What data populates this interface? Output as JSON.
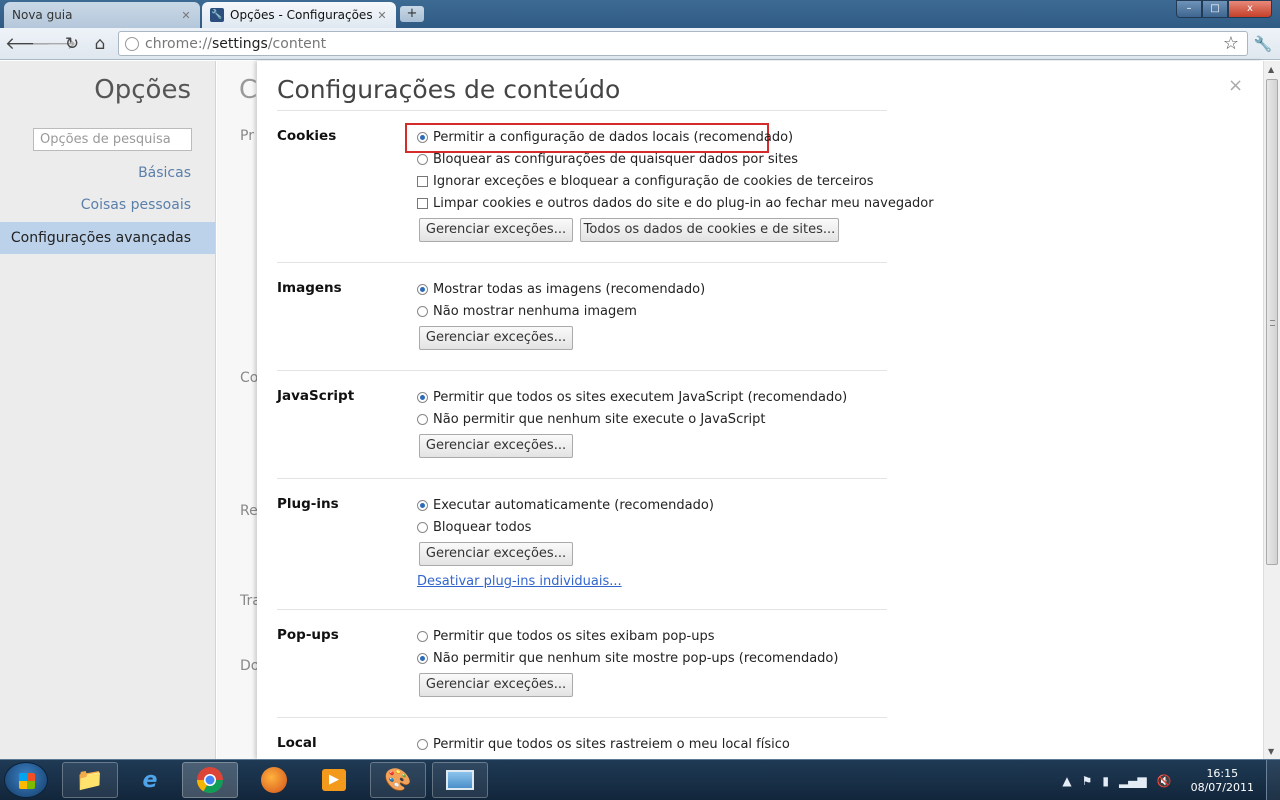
{
  "browser": {
    "tabs": [
      {
        "title": "Nova guia",
        "active": false
      },
      {
        "title": "Opções - Configurações de",
        "active": true
      }
    ],
    "new_tab_symbol": "+",
    "window_controls": {
      "minimize": "–",
      "maximize": "□",
      "close": "x"
    },
    "url_prefix": "chrome://",
    "url_path": "settings",
    "url_suffix": "/content"
  },
  "sidebar": {
    "title": "Opções",
    "search_placeholder": "Opções de pesquisa",
    "items": [
      {
        "label": "Básicas",
        "selected": false
      },
      {
        "label": "Coisas pessoais",
        "selected": false
      },
      {
        "label": "Configurações avançadas",
        "selected": true
      }
    ]
  },
  "background_page": {
    "title_fragment": "C",
    "section_fragments": [
      "Pr",
      "Co",
      "Re",
      "Tra",
      "Do"
    ]
  },
  "dialog": {
    "title": "Configurações de conteúdo",
    "close_symbol": "×",
    "sections": {
      "cookies": {
        "heading": "Cookies",
        "options": [
          {
            "type": "radio",
            "checked": true,
            "label": "Permitir a configuração de dados locais (recomendado)"
          },
          {
            "type": "radio",
            "checked": false,
            "label": "Bloquear as configurações de quaisquer dados por sites"
          },
          {
            "type": "checkbox",
            "checked": false,
            "label": "Ignorar exceções e bloquear a configuração de cookies de terceiros"
          },
          {
            "type": "checkbox",
            "checked": false,
            "label": "Limpar cookies e outros dados do site e do plug-in ao fechar meu navegador"
          }
        ],
        "buttons": [
          "Gerenciar exceções...",
          "Todos os dados de cookies e de sites..."
        ]
      },
      "images": {
        "heading": "Imagens",
        "options": [
          {
            "type": "radio",
            "checked": true,
            "label": "Mostrar todas as imagens (recomendado)"
          },
          {
            "type": "radio",
            "checked": false,
            "label": "Não mostrar nenhuma imagem"
          }
        ],
        "button": "Gerenciar exceções..."
      },
      "javascript": {
        "heading": "JavaScript",
        "options": [
          {
            "type": "radio",
            "checked": true,
            "label": "Permitir que todos os sites executem JavaScript (recomendado)"
          },
          {
            "type": "radio",
            "checked": false,
            "label": "Não permitir que nenhum site execute o JavaScript"
          }
        ],
        "button": "Gerenciar exceções..."
      },
      "plugins": {
        "heading": "Plug-ins",
        "options": [
          {
            "type": "radio",
            "checked": true,
            "label": "Executar automaticamente (recomendado)"
          },
          {
            "type": "radio",
            "checked": false,
            "label": "Bloquear todos"
          }
        ],
        "button": "Gerenciar exceções...",
        "link": "Desativar plug-ins individuais..."
      },
      "popups": {
        "heading": "Pop-ups",
        "options": [
          {
            "type": "radio",
            "checked": false,
            "label": "Permitir que todos os sites exibam pop-ups"
          },
          {
            "type": "radio",
            "checked": true,
            "label": "Não permitir que nenhum site mostre pop-ups (recomendado)"
          }
        ],
        "button": "Gerenciar exceções..."
      },
      "location": {
        "heading": "Local",
        "options": [
          {
            "type": "radio",
            "checked": false,
            "label": "Permitir que todos os sites rastreiem o meu local físico"
          }
        ]
      }
    },
    "highlight_color": "#d42b2b"
  },
  "taskbar": {
    "apps": [
      "explorer-icon",
      "internet-explorer-icon",
      "chrome-icon",
      "firefox-icon",
      "media-player-icon",
      "paint-icon",
      "photo-viewer-icon"
    ],
    "clock_time": "16:15",
    "clock_date": "08/07/2011"
  },
  "colors": {
    "accent": "#3366cc",
    "selected_sidebar": "#bcd2ea"
  }
}
